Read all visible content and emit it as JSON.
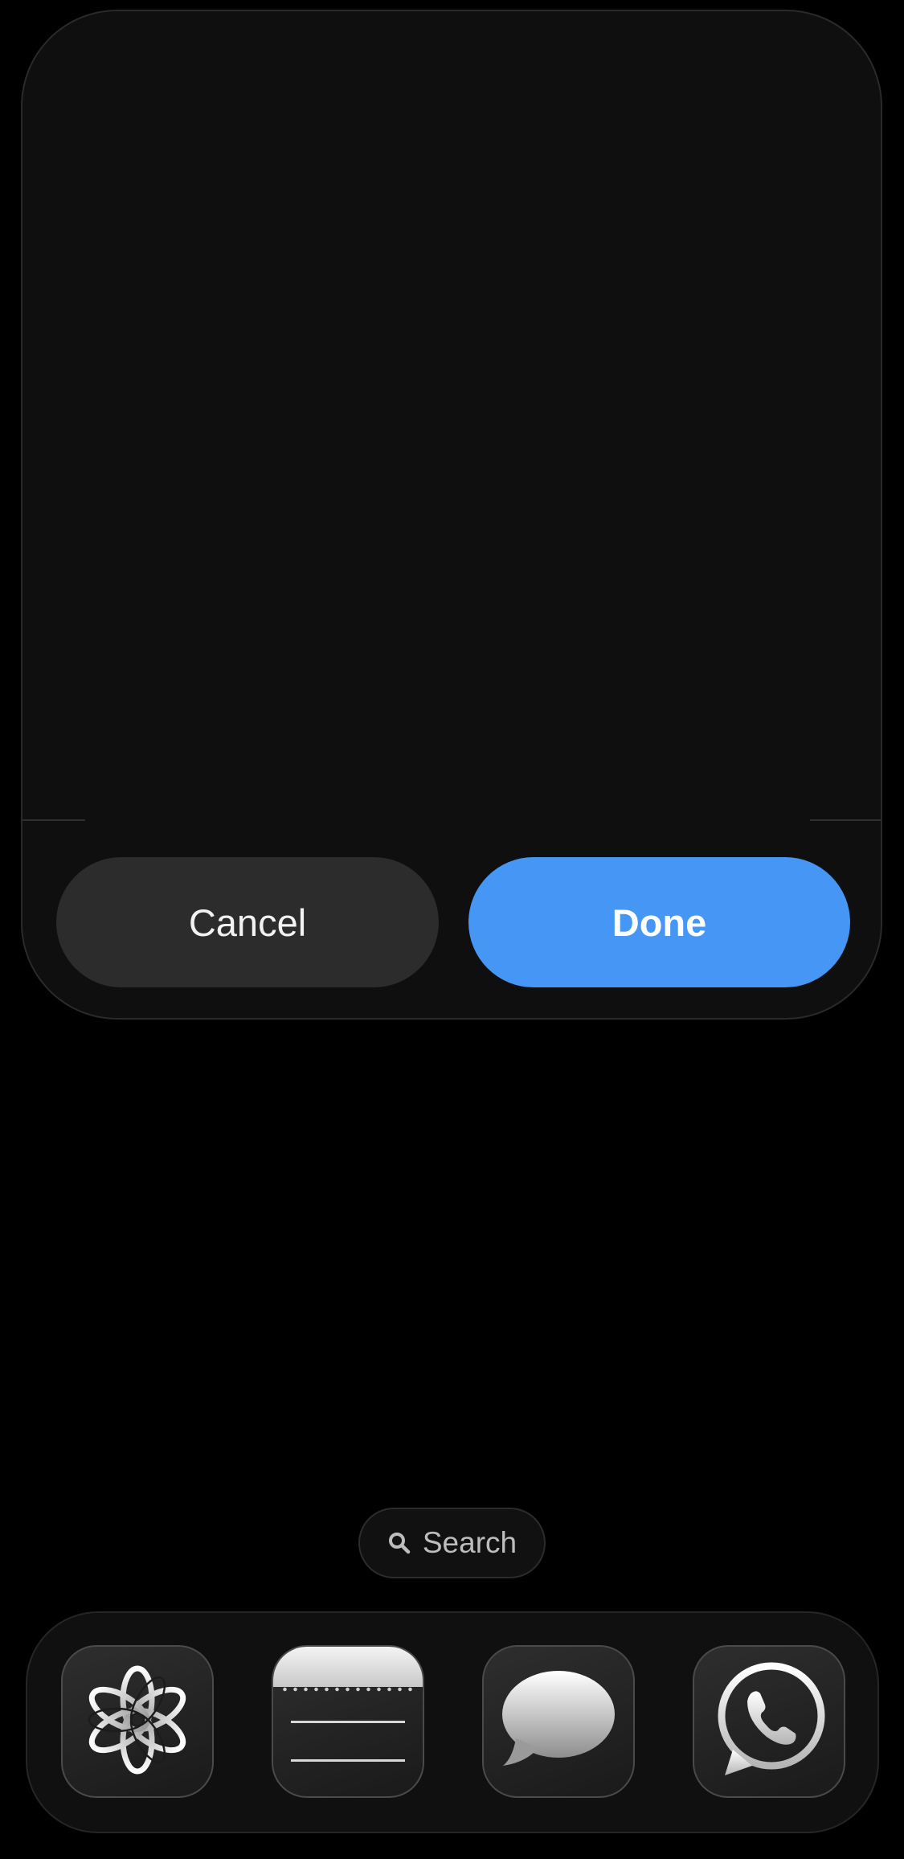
{
  "dialog": {
    "cancel_label": "Cancel",
    "done_label": "Done",
    "done_color": "#4596f5",
    "cancel_color": "#2c2c2c"
  },
  "search": {
    "label": "Search",
    "icon": "search-icon"
  },
  "dock": {
    "apps": [
      {
        "name": "chatgpt",
        "icon": "openai-knot-icon"
      },
      {
        "name": "notes",
        "icon": "notes-icon"
      },
      {
        "name": "messages",
        "icon": "message-bubble-icon"
      },
      {
        "name": "whatsapp",
        "icon": "whatsapp-phone-icon"
      }
    ]
  },
  "colors": {
    "background": "#000000",
    "sheet": "#0f0f0f"
  }
}
